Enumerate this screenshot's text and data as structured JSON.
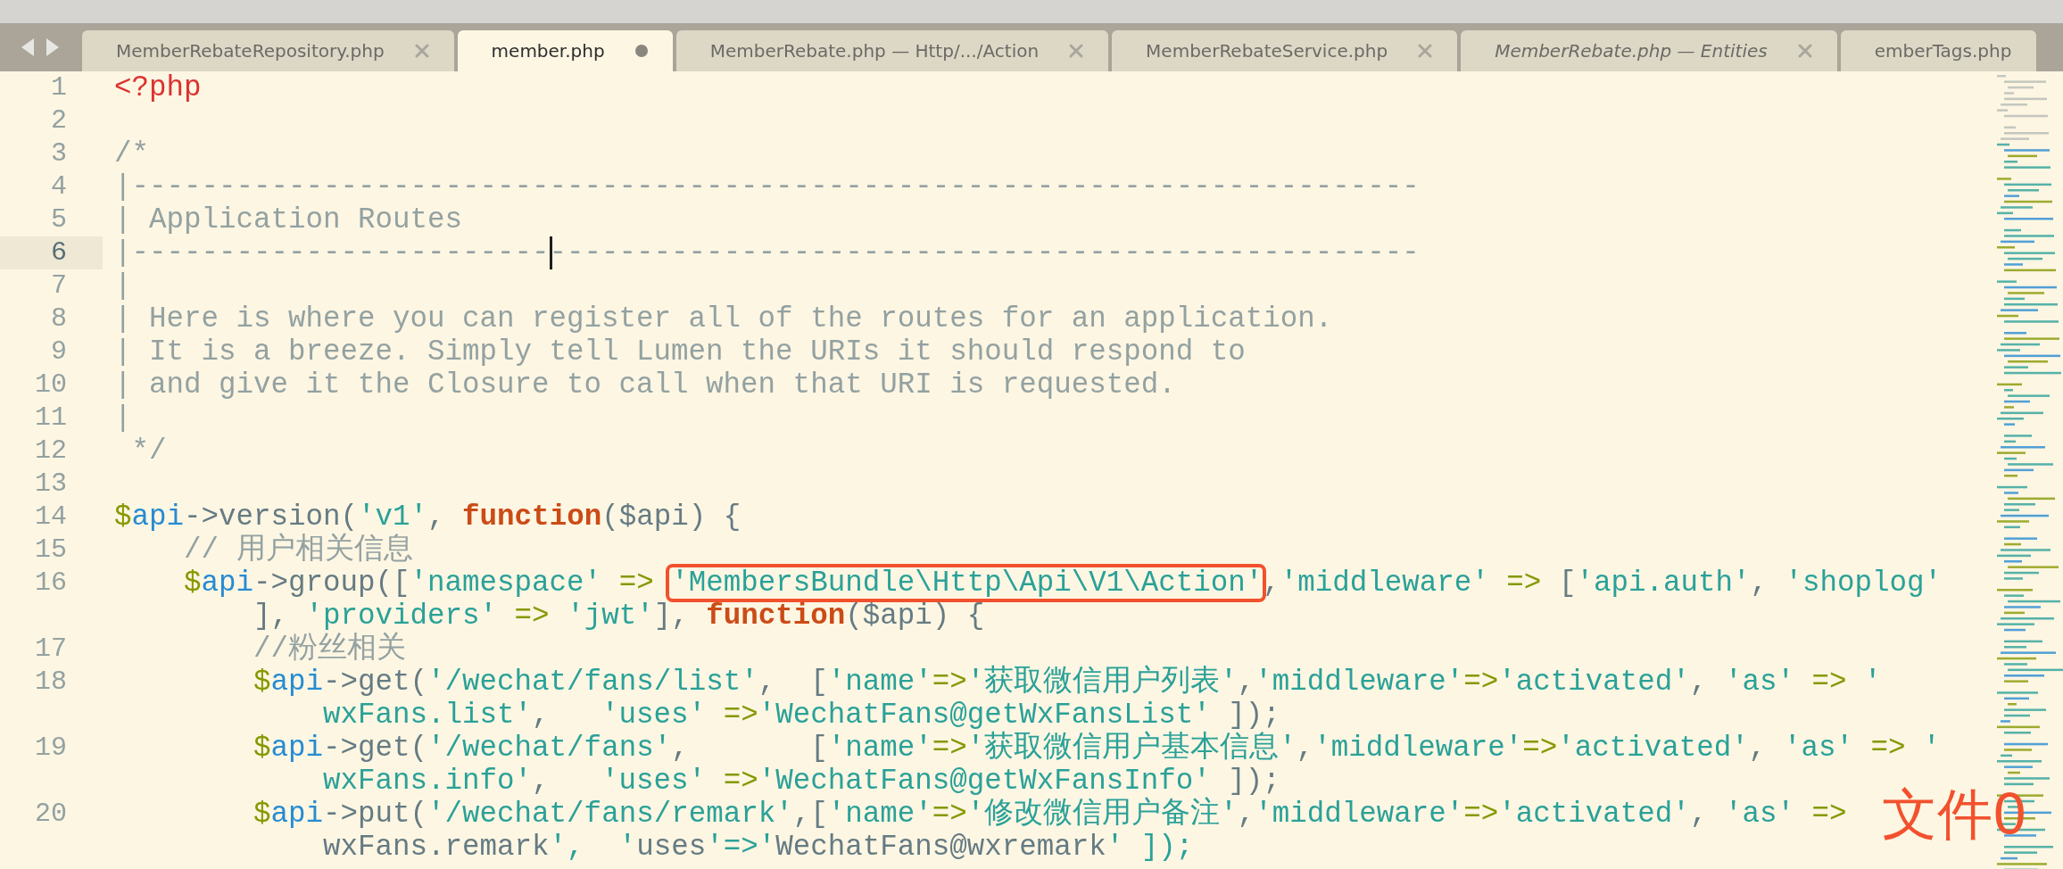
{
  "tabs": [
    {
      "label": "MemberRebateRepository.php",
      "selected": false,
      "modified": false,
      "italic": false,
      "closable": true
    },
    {
      "label": "member.php",
      "selected": true,
      "modified": true,
      "italic": false,
      "closable": false
    },
    {
      "label": "MemberRebate.php — Http/.../Action",
      "selected": false,
      "modified": false,
      "italic": false,
      "closable": true
    },
    {
      "label": "MemberRebateService.php",
      "selected": false,
      "modified": false,
      "italic": false,
      "closable": true
    },
    {
      "label": "MemberRebate.php — Entities",
      "selected": false,
      "modified": false,
      "italic": true,
      "closable": true
    },
    {
      "label": "emberTags.php",
      "selected": false,
      "modified": false,
      "italic": false,
      "closable": false
    }
  ],
  "lines": [
    {
      "number": "1",
      "current": false,
      "rows": [
        "<?php"
      ]
    },
    {
      "number": "2",
      "current": false
    },
    {
      "number": "3",
      "current": false,
      "rows": [
        "/*"
      ]
    },
    {
      "number": "4",
      "current": false,
      "rows": [
        "|--------------------------------------------------------------------------"
      ]
    },
    {
      "number": "5",
      "current": false,
      "rows": [
        "| Application Routes"
      ]
    },
    {
      "number": "6",
      "current": true,
      "rows": [
        {
          "before": "|------------------------",
          "after": "--------------------------------------------------",
          "caret": true
        }
      ]
    },
    {
      "number": "7",
      "current": false,
      "rows": [
        "|"
      ]
    },
    {
      "number": "8",
      "current": false,
      "rows": [
        "| Here is where you can register all of the routes for an application."
      ]
    },
    {
      "number": "9",
      "current": false,
      "rows": [
        "| It is a breeze. Simply tell Lumen the URIs it should respond to"
      ]
    },
    {
      "number": "10",
      "current": false,
      "rows": [
        "| and give it the Closure to call when that URI is requested."
      ]
    },
    {
      "number": "11",
      "current": false,
      "rows": [
        "|"
      ]
    },
    {
      "number": "12",
      "current": false,
      "rows": [
        " */"
      ]
    },
    {
      "number": "13",
      "current": false
    },
    {
      "number": "14",
      "current": false,
      "rows": [
        "$api->version('v1', function($api) {"
      ]
    },
    {
      "number": "15",
      "current": false,
      "rows": [
        "    // 用户相关信息"
      ]
    },
    {
      "number": "16",
      "current": false,
      "rows": [
        {
          "before": "    $api->group(['namespace' => ",
          "boxed": "'MembersBundle\\Http\\Api\\V1\\Action'",
          "after": ",'middleware' => ['api.auth', 'shoplog'"
        },
        "        ], 'providers' => 'jwt'], function($api) {"
      ]
    },
    {
      "number": "17",
      "current": false,
      "rows": [
        "        //粉丝相关"
      ]
    },
    {
      "number": "18",
      "current": false,
      "rows": [
        "        $api->get('/wechat/fans/list',  ['name'=>'获取微信用户列表','middleware'=>'activated', 'as' => '",
        "            wxFans.list',   'uses' =>'WechatFans@getWxFansList' ]);"
      ]
    },
    {
      "number": "19",
      "current": false,
      "rows": [
        "        $api->get('/wechat/fans',       ['name'=>'获取微信用户基本信息','middleware'=>'activated', 'as' => '",
        "            wxFans.info',   'uses' =>'WechatFans@getWxFansInfo' ]);"
      ]
    },
    {
      "number": "20",
      "current": false,
      "rows": [
        "        $api->put('/wechat/fans/remark',['name'=>'修改微信用户备注','middleware'=>'activated', 'as' =>",
        "            wxFans.remark',  'uses'=>'WechatFans@wxremark' ]);"
      ]
    }
  ],
  "annotation_label": "文件0"
}
